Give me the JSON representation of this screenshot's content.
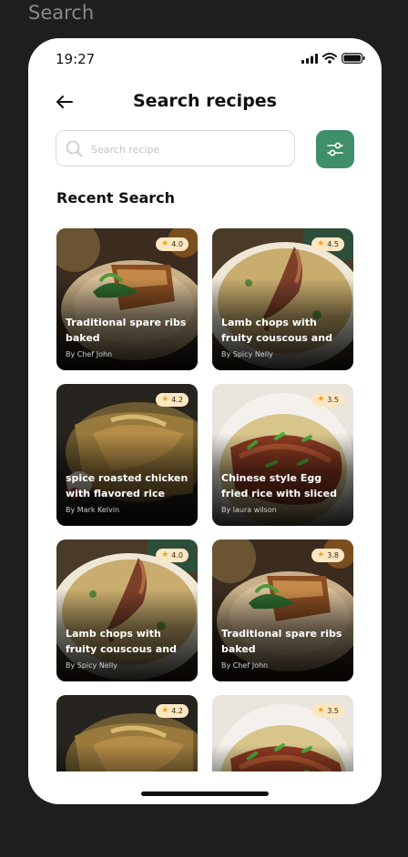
{
  "frame": {
    "label": "Search"
  },
  "status_bar": {
    "time": "19:27"
  },
  "header": {
    "title": "Search recipes"
  },
  "search": {
    "placeholder": "Search recipe",
    "value": ""
  },
  "section": {
    "title": "Recent Search"
  },
  "colors": {
    "accent": "#3f8f6a",
    "badge_bg": "#fbe7c2",
    "star": "#f0a22a"
  },
  "recipes": [
    {
      "title": "Traditional spare ribs baked",
      "author": "By Chef John",
      "rating": "4.0",
      "image": "ribs"
    },
    {
      "title": "Lamb chops with fruity couscous and mint…",
      "author": "By Spicy Nelly",
      "rating": "4.5",
      "image": "lamb"
    },
    {
      "title": "spice roasted chicken with flavored rice",
      "author": "By Mark Kelvin",
      "rating": "4.2",
      "image": "chicken"
    },
    {
      "title": "Chinese style Egg fried rice with sliced pork…",
      "author": "By laura wilson",
      "rating": "3.5",
      "image": "friedrice"
    },
    {
      "title": "Lamb chops with fruity couscous and mint…",
      "author": "By Spicy Nelly",
      "rating": "4.0",
      "image": "lamb"
    },
    {
      "title": "Traditional spare ribs baked",
      "author": "By Chef John",
      "rating": "3.8",
      "image": "ribs"
    },
    {
      "title": "",
      "author": "",
      "rating": "4.2",
      "image": "chicken"
    },
    {
      "title": "",
      "author": "",
      "rating": "3.5",
      "image": "friedrice"
    }
  ]
}
